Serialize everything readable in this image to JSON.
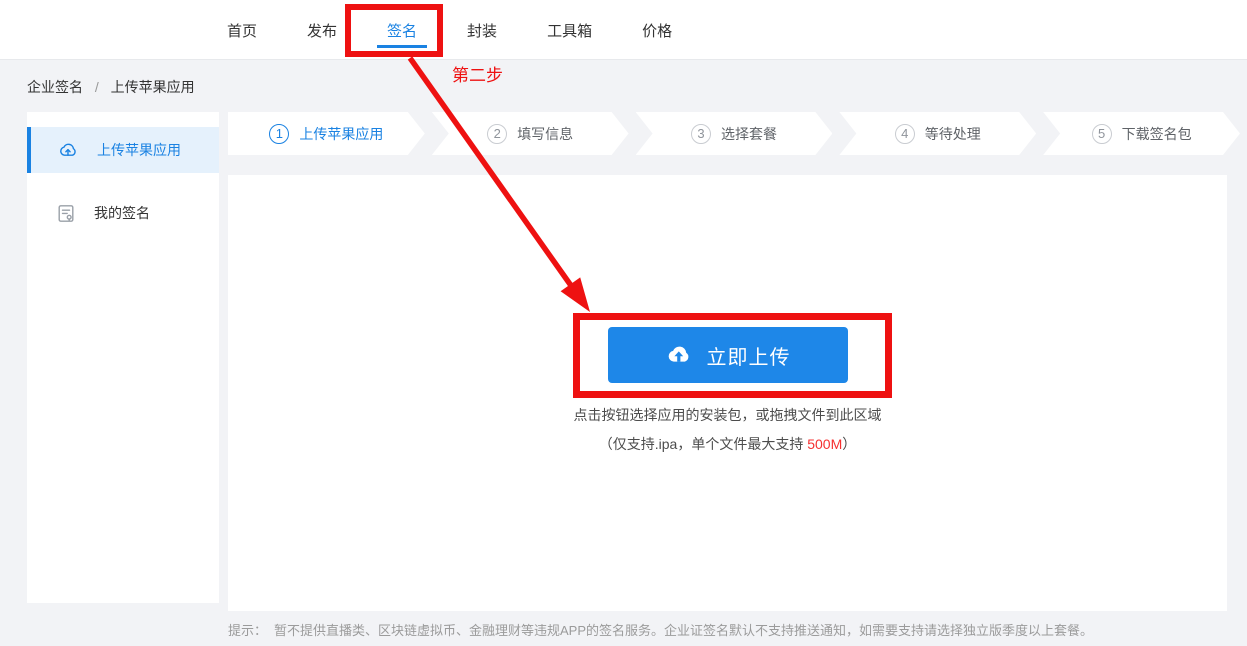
{
  "header": {
    "nav": [
      {
        "label": "首页",
        "active": false
      },
      {
        "label": "发布",
        "active": false
      },
      {
        "label": "签名",
        "active": true
      },
      {
        "label": "封装",
        "active": false
      },
      {
        "label": "工具箱",
        "active": false
      },
      {
        "label": "价格",
        "active": false
      }
    ]
  },
  "breadcrumb": {
    "parent": "企业签名",
    "separator": "/",
    "current": "上传苹果应用"
  },
  "sidebar": {
    "items": [
      {
        "label": "上传苹果应用",
        "icon": "cloud-upload-icon",
        "active": true
      },
      {
        "label": "我的签名",
        "icon": "signature-document-icon",
        "active": false
      }
    ]
  },
  "steps": {
    "items": [
      {
        "num": "1",
        "label": "上传苹果应用",
        "active": true
      },
      {
        "num": "2",
        "label": "填写信息",
        "active": false
      },
      {
        "num": "3",
        "label": "选择套餐",
        "active": false
      },
      {
        "num": "4",
        "label": "等待处理",
        "active": false
      },
      {
        "num": "5",
        "label": "下载签名包",
        "active": false
      }
    ]
  },
  "upload": {
    "button_label": "立即上传",
    "button_icon": "cloud-upload-filled-icon",
    "hint_line1": "点击按钮选择应用的安装包，或拖拽文件到此区域",
    "hint_line2_prefix": "（仅支持.ipa，单个文件最大支持 ",
    "hint_line2_highlight": "500M",
    "hint_line2_suffix": "）"
  },
  "footer": {
    "tip_label": "提示：",
    "tip_text": "暂不提供直播类、区块链虚拟币、金融理财等违规APP的签名服务。企业证签名默认不支持推送通知，如需要支持请选择独立版季度以上套餐。"
  },
  "annotations": {
    "step_note": "第二步"
  },
  "colors": {
    "accent_blue": "#1a82e2",
    "button_blue": "#1e87e8",
    "annotation_red": "#ee1111",
    "highlight_red": "#f53030",
    "sidebar_active_bg": "#e5f1fc",
    "page_bg": "#f2f3f6"
  }
}
